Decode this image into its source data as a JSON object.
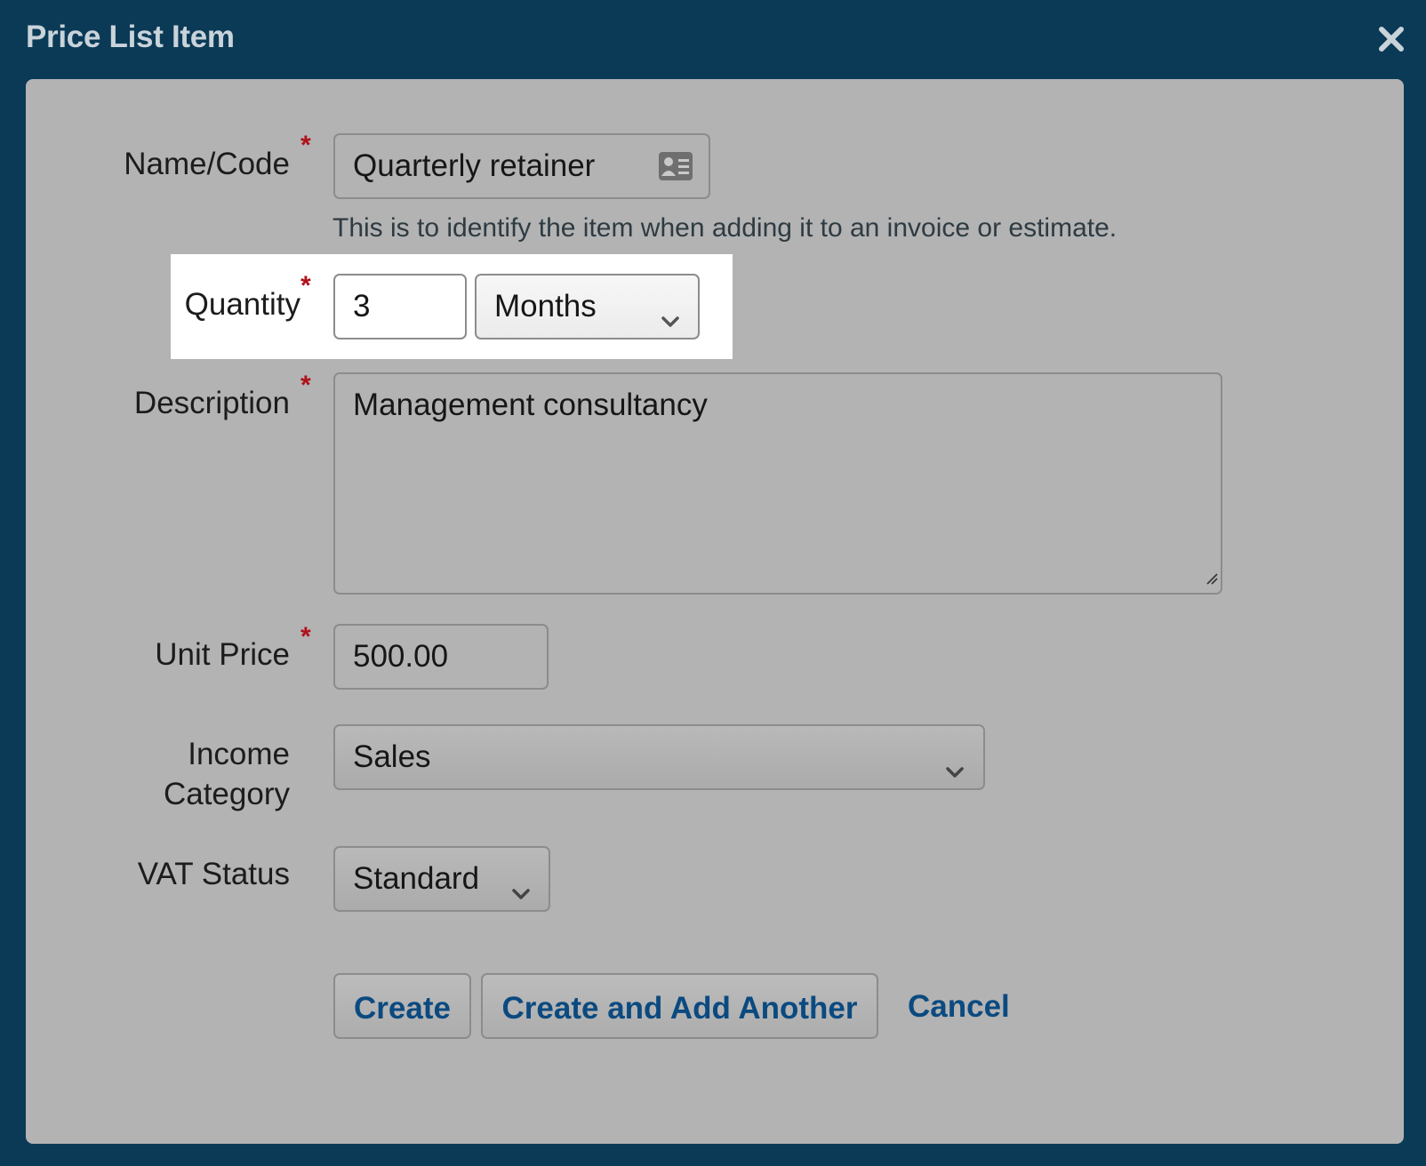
{
  "dialog": {
    "title": "Price List Item",
    "close_icon": "close-icon"
  },
  "form": {
    "name_code": {
      "label": "Name/Code",
      "value": "Quarterly retainer",
      "icon": "contact-card-icon",
      "hint": "This is to identify the item when adding it to an invoice or estimate."
    },
    "quantity": {
      "label": "Quantity",
      "value": "3",
      "unit_selected": "Months"
    },
    "description": {
      "label": "Description",
      "value": "Management consultancy"
    },
    "unit_price": {
      "label": "Unit Price",
      "value": "500.00"
    },
    "income_category": {
      "label_line1": "Income",
      "label_line2": "Category",
      "selected": "Sales"
    },
    "vat_status": {
      "label": "VAT Status",
      "selected": "Standard"
    },
    "required_marker": "*"
  },
  "actions": {
    "create_label": "Create",
    "create_another_label": "Create and Add Another",
    "cancel_label": "Cancel"
  },
  "colors": {
    "header_bg": "#0b3a56",
    "panel_bg": "#b3b3b3",
    "required": "#b0111b",
    "link": "#0b4a80"
  }
}
